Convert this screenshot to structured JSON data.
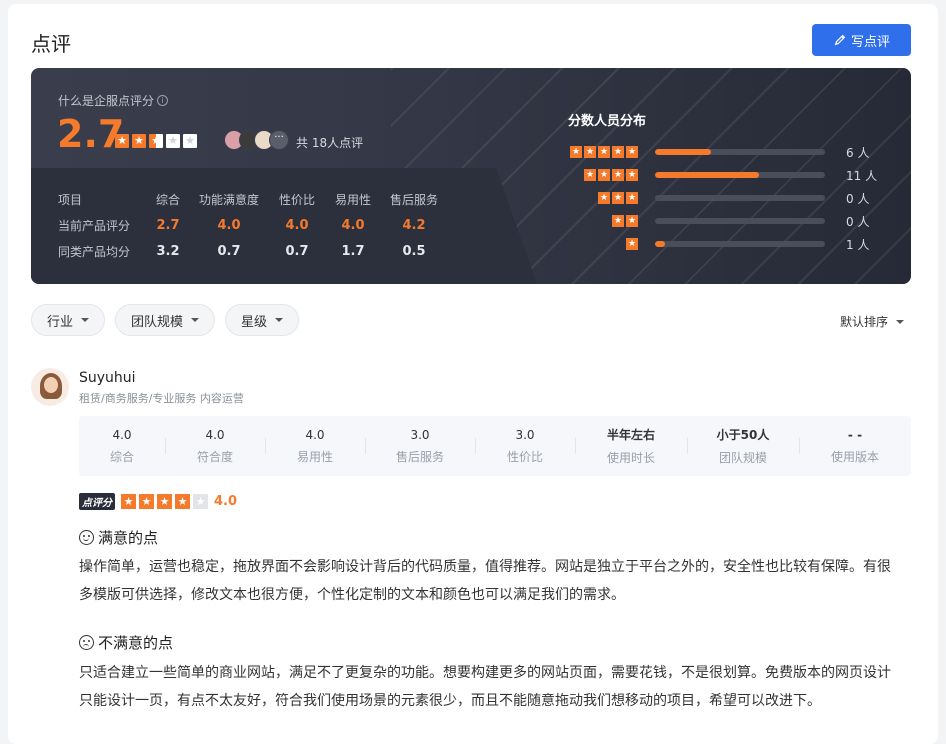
{
  "header": {
    "title": "点评",
    "write_label": "写点评"
  },
  "summary": {
    "what_label": "什么是企服点评分",
    "score": "2.7",
    "stars": 2.5,
    "more": "···",
    "total_reviews": "共 18人点评",
    "table": {
      "head": [
        "项目",
        "综合",
        "功能满意度",
        "性价比",
        "易用性",
        "售后服务"
      ],
      "current_label": "当前产品评分",
      "current": [
        "2.7",
        "4.0",
        "4.0",
        "4.0",
        "4.2"
      ],
      "average_label": "同类产品均分",
      "average": [
        "3.2",
        "0.7",
        "0.7",
        "1.7",
        "0.5"
      ]
    }
  },
  "distribution": {
    "title": "分数人员分布",
    "rows": [
      {
        "stars": 5,
        "count": "6 人",
        "fraction": 0.33
      },
      {
        "stars": 4,
        "count": "11 人",
        "fraction": 0.61
      },
      {
        "stars": 3,
        "count": "0 人",
        "fraction": 0
      },
      {
        "stars": 2,
        "count": "0 人",
        "fraction": 0
      },
      {
        "stars": 1,
        "count": "1 人",
        "fraction": 0.06
      }
    ]
  },
  "filters": [
    "行业",
    "团队规模",
    "星级"
  ],
  "sort_label": "默认排序",
  "review": {
    "name": "Suyuhui",
    "meta": "租赁/商务服务/专业服务  内容运营",
    "metrics": [
      {
        "value": "4.0",
        "label": "综合"
      },
      {
        "value": "4.0",
        "label": "符合度"
      },
      {
        "value": "4.0",
        "label": "易用性"
      },
      {
        "value": "3.0",
        "label": "售后服务"
      },
      {
        "value": "3.0",
        "label": "性价比"
      },
      {
        "value": "半年左右",
        "label": "使用时长"
      },
      {
        "value": "小于50人",
        "label": "团队规模"
      },
      {
        "value": "- -",
        "label": "使用版本"
      }
    ],
    "badge": "点评分",
    "rating": "4.0",
    "rating_stars": 4,
    "satisfied_title": "满意的点",
    "satisfied_text": "操作简单，运营也稳定，拖放界面不会影响设计背后的代码质量，值得推荐。网站是独立于平台之外的，安全性也比较有保障。有很多模版可供选择，修改文本也很方便，个性化定制的文本和颜色也可以满足我们的需求。",
    "unsatisfied_title": "不满意的点",
    "unsatisfied_text": "只适合建立一些简单的商业网站，满足不了更复杂的功能。想要构建更多的网站页面，需要花钱，不是很划算。免费版本的网页设计只能设计一页，有点不太友好，符合我们使用场景的元素很少，而且不能随意拖动我们想移动的项目，希望可以改进下。"
  },
  "colors": {
    "accent": "#f57a2c",
    "primary": "#2f6fec",
    "panel": "#343846"
  }
}
